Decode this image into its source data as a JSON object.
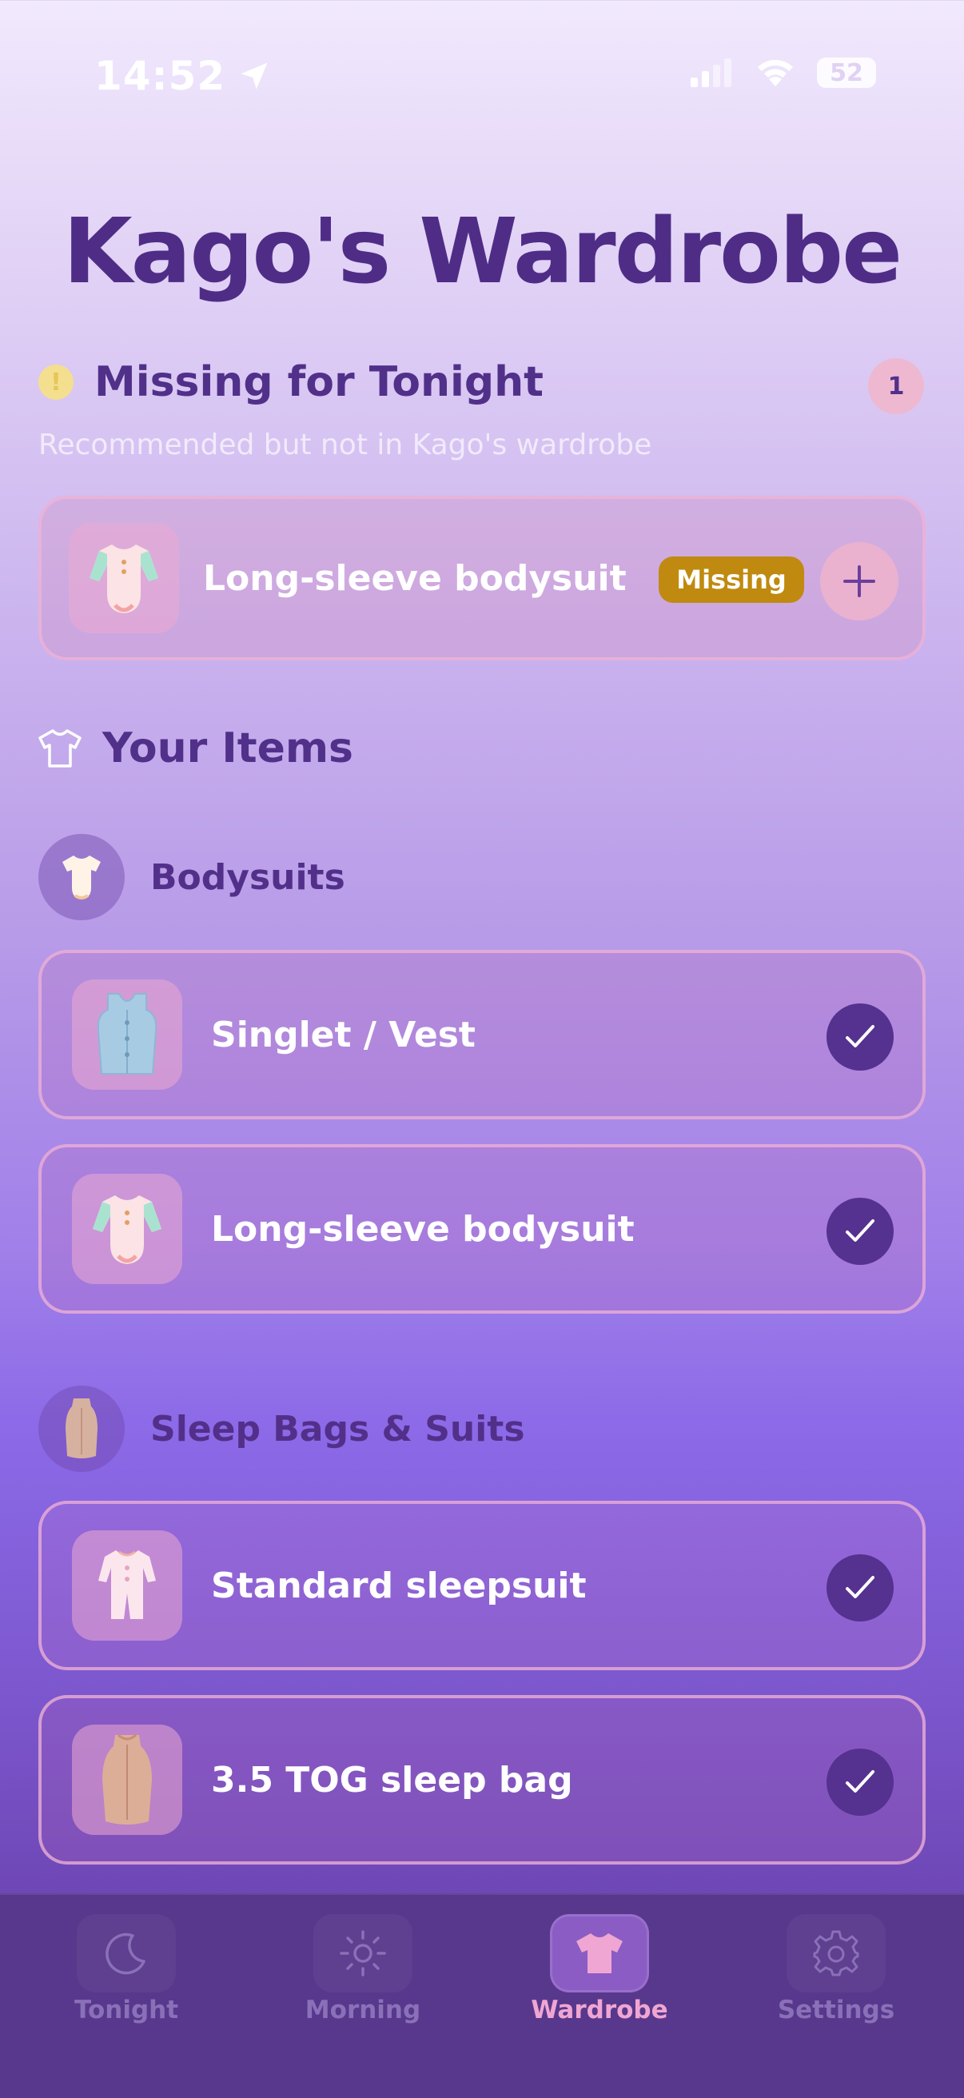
{
  "status_bar": {
    "time": "14:52",
    "battery": "52"
  },
  "page_title": "Kago's Wardrobe",
  "missing_section": {
    "title": "Missing for Tonight",
    "count": "1",
    "subtitle": "Recommended but not in Kago's wardrobe",
    "items": [
      {
        "label": "Long-sleeve bodysuit",
        "badge": "Missing",
        "icon": "long-sleeve-bodysuit-icon"
      }
    ]
  },
  "your_items": {
    "title": "Your Items",
    "categories": [
      {
        "label": "Bodysuits",
        "icon": "bodysuit-icon",
        "items": [
          {
            "label": "Singlet / Vest",
            "icon": "vest-icon",
            "owned": true
          },
          {
            "label": "Long-sleeve bodysuit",
            "icon": "long-sleeve-bodysuit-icon",
            "owned": true
          }
        ]
      },
      {
        "label": "Sleep Bags & Suits",
        "icon": "sleep-bag-icon",
        "items": [
          {
            "label": "Standard sleepsuit",
            "icon": "sleepsuit-icon",
            "owned": true
          },
          {
            "label": "3.5 TOG sleep bag",
            "icon": "sleep-bag-icon",
            "owned": true
          }
        ]
      }
    ]
  },
  "tabs": [
    {
      "label": "Tonight",
      "icon": "moon-icon",
      "active": false
    },
    {
      "label": "Morning",
      "icon": "sun-icon",
      "active": false
    },
    {
      "label": "Wardrobe",
      "icon": "tshirt-icon",
      "active": true
    },
    {
      "label": "Settings",
      "icon": "gear-icon",
      "active": false
    }
  ],
  "colors": {
    "title": "#4f2d86",
    "check": "#553190",
    "missing_badge": "#c08a10",
    "tab_active": "#f0a6d2"
  }
}
